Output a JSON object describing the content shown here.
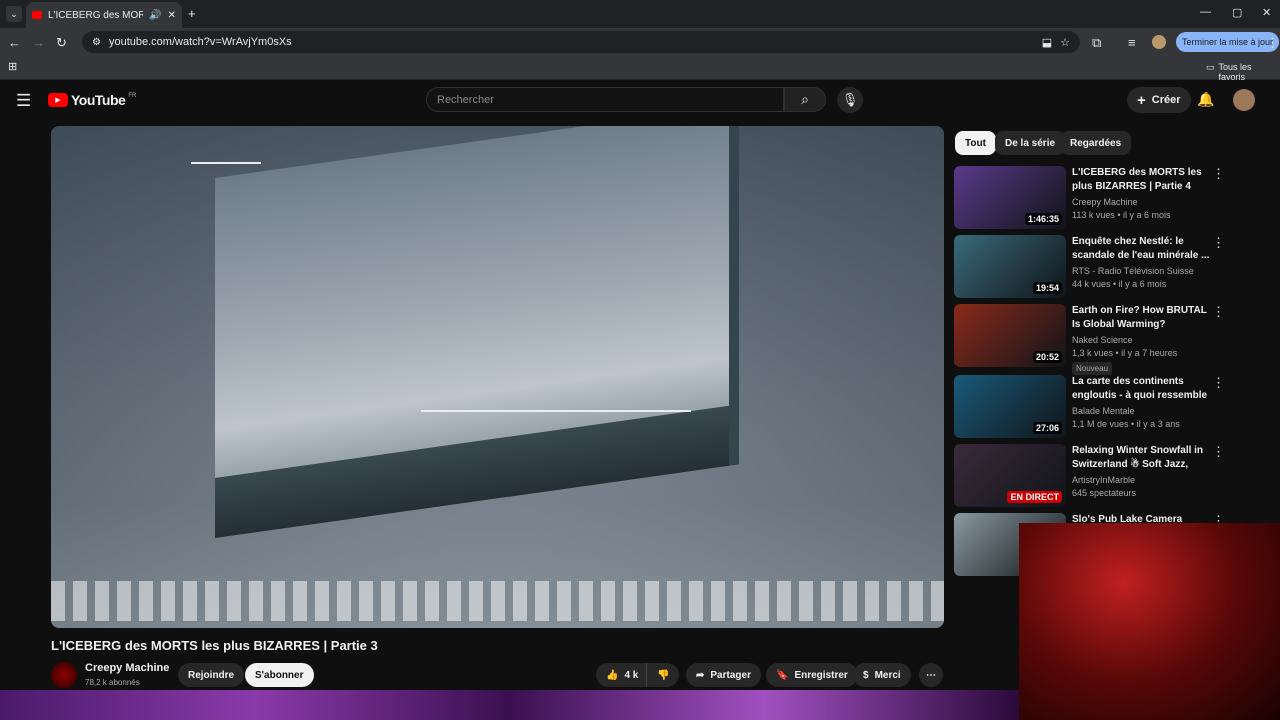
{
  "browser": {
    "tab_title": "L'ICEBERG des MORTS les plus...",
    "url": "youtube.com/watch?v=WrAvjYm0sXs",
    "update_button": "Terminer la mise à jour",
    "bookmarks_label": "Tous les favoris"
  },
  "youtube": {
    "logo_text": "YouTube",
    "region": "FR",
    "search_placeholder": "Rechercher",
    "create_label": "Créer"
  },
  "video": {
    "title": "L'ICEBERG des MORTS les plus BIZARRES | Partie 3",
    "channel": "Creepy Machine",
    "subscribers": "78,2 k abonnés",
    "join_label": "Rejoindre",
    "subscribe_label": "S'abonner",
    "likes": "4 k",
    "share_label": "Partager",
    "save_label": "Enregistrer",
    "thanks_label": "Merci"
  },
  "filters": [
    "Tout",
    "De la série",
    "Regardées"
  ],
  "sidebar": [
    {
      "title": "L'ICEBERG des MORTS les plus BIZARRES | Partie 4",
      "channel": "Creepy Machine",
      "meta": "113 k vues • il y a 6 mois",
      "duration": "1:46:35",
      "color": "#5a3a8a"
    },
    {
      "title": "Enquête chez Nestlé: le scandale de l'eau minérale ...",
      "channel": "RTS - Radio Télévision Suisse",
      "meta": "44 k vues • il y a 6 mois",
      "duration": "19:54",
      "color": "#3a6a7a"
    },
    {
      "title": "Earth on Fire? How BRUTAL Is Global Warming?",
      "channel": "Naked Science",
      "meta": "1,3 k vues • il y a 7 heures",
      "duration": "20:52",
      "badge": "Nouveau",
      "color": "#8a2a1a"
    },
    {
      "title": "La carte des continents engloutis - à quoi ressemble la...",
      "channel": "Balade Mentale",
      "meta": "1,1 M de vues • il y a 3 ans",
      "duration": "27:06",
      "color": "#1a5a7a"
    },
    {
      "title": "Relaxing Winter Snowfall in Switzerland ☃ Soft Jazz, Coz...",
      "channel": "ArtistryInMarble",
      "meta": "645 spectateurs",
      "duration": "EN DIRECT",
      "color": "#3a2a3a"
    },
    {
      "title": "Slo's Pub Lake Camera",
      "channel": "",
      "meta": "",
      "duration": "",
      "color": "#8a9aa0"
    }
  ]
}
